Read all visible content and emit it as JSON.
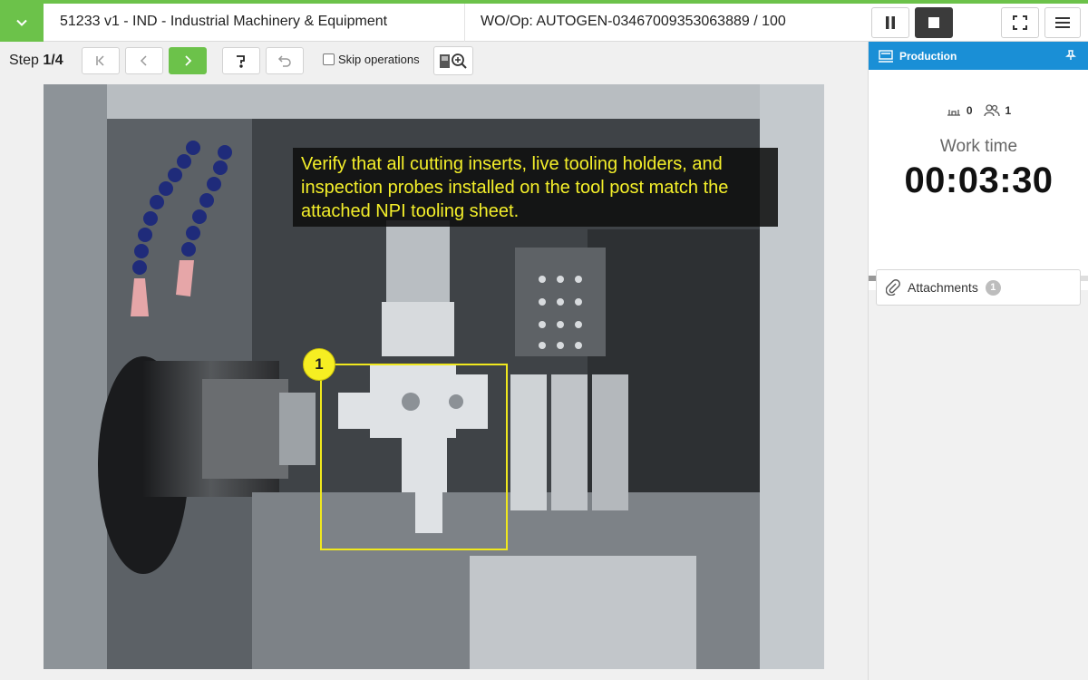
{
  "header": {
    "title": "51233 v1 - IND - Industrial Machinery & Equipment",
    "wo_op": "WO/Op:  AUTOGEN-03467009353063889 / 100"
  },
  "toolbar": {
    "step_prefix": "Step ",
    "step_value": "1/4",
    "skip_label": "Skip operations",
    "skip_checked": false
  },
  "instruction": {
    "callout_text": "Verify that all cutting inserts, live tooling holders, and inspection probes installed on the tool post match the attached NPI tooling sheet.",
    "marker_number": "1"
  },
  "right_panel": {
    "production_title": "Production",
    "station_count": "0",
    "operator_count": "1",
    "work_time_label": "Work time",
    "work_time": "00:03:30",
    "progress_total_steps": 4,
    "progress_current_step": 1,
    "attachments_label": "Attachments",
    "attachments_count": "1"
  },
  "colors": {
    "accent_green": "#6cc24a",
    "production_blue": "#1a8fd6",
    "callout_text": "#f4ef2a",
    "marker_yellow": "#f0e81e"
  },
  "icons": [
    "chevron-down-icon",
    "pause-icon",
    "stop-icon",
    "fullscreen-icon",
    "hamburger-menu-icon",
    "first-step-icon",
    "prev-icon",
    "next-icon",
    "help-icon",
    "undo-icon",
    "zoom-in-icon",
    "production-icon",
    "pin-icon",
    "station-icon",
    "users-icon",
    "paperclip-icon"
  ]
}
